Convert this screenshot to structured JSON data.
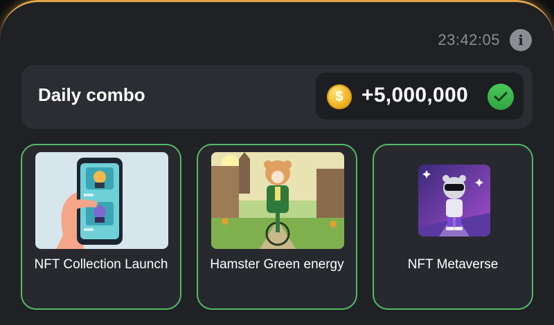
{
  "header": {
    "timer": "23:42:05",
    "info_icon": "info-icon"
  },
  "combo": {
    "title": "Daily combo",
    "reward": "+5,000,000",
    "coin_icon": "coin-icon",
    "coin_glyph": "$",
    "status_icon": "checkmark-icon"
  },
  "cards": [
    {
      "label": "NFT Collection Launch",
      "image": "phone-nft-image"
    },
    {
      "label": "Hamster Green energy",
      "image": "hamster-bicycle-image"
    },
    {
      "label": "NFT Metaverse",
      "image": "hamster-metaverse-image"
    }
  ],
  "colors": {
    "accent_border": "#e5a74a",
    "card_border": "#58b964",
    "check_green": "#3bb54d",
    "coin_gold": "#f0b21f"
  }
}
